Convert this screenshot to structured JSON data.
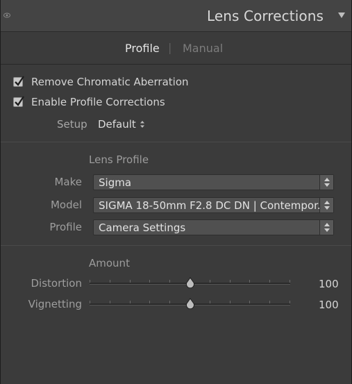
{
  "panel": {
    "title": "Lens Corrections"
  },
  "tabs": [
    {
      "label": "Profile",
      "active": true
    },
    {
      "label": "|",
      "active": false
    },
    {
      "label": "Manual",
      "active": false
    }
  ],
  "checkboxes": [
    {
      "label": "Remove Chromatic Aberration",
      "checked": true
    },
    {
      "label": "Enable Profile Corrections",
      "checked": true
    }
  ],
  "setup": {
    "label": "Setup",
    "value": "Default"
  },
  "lens_profile": {
    "title": "Lens Profile",
    "make_label": "Make",
    "make_value": "Sigma",
    "model_label": "Model",
    "model_value": "SIGMA 18-50mm F2.8 DC DN | Contempor...",
    "profile_label": "Profile",
    "profile_value": "Camera Settings"
  },
  "amount": {
    "title": "Amount",
    "sliders": [
      {
        "label": "Distortion",
        "value": "100",
        "level": 0.5
      },
      {
        "label": "Vignetting",
        "value": "100",
        "level": 0.5
      }
    ]
  },
  "colors": {
    "panel_bg": "#3b3b3b",
    "header_bg": "#444444",
    "text": "#d4d4d4",
    "muted": "#9e9e9e"
  },
  "icons": {
    "header_left": "eye-icon",
    "header_right": "triangle-down-icon",
    "select_arrows": "up-down-arrows-icon",
    "check": "checkmark-icon"
  }
}
